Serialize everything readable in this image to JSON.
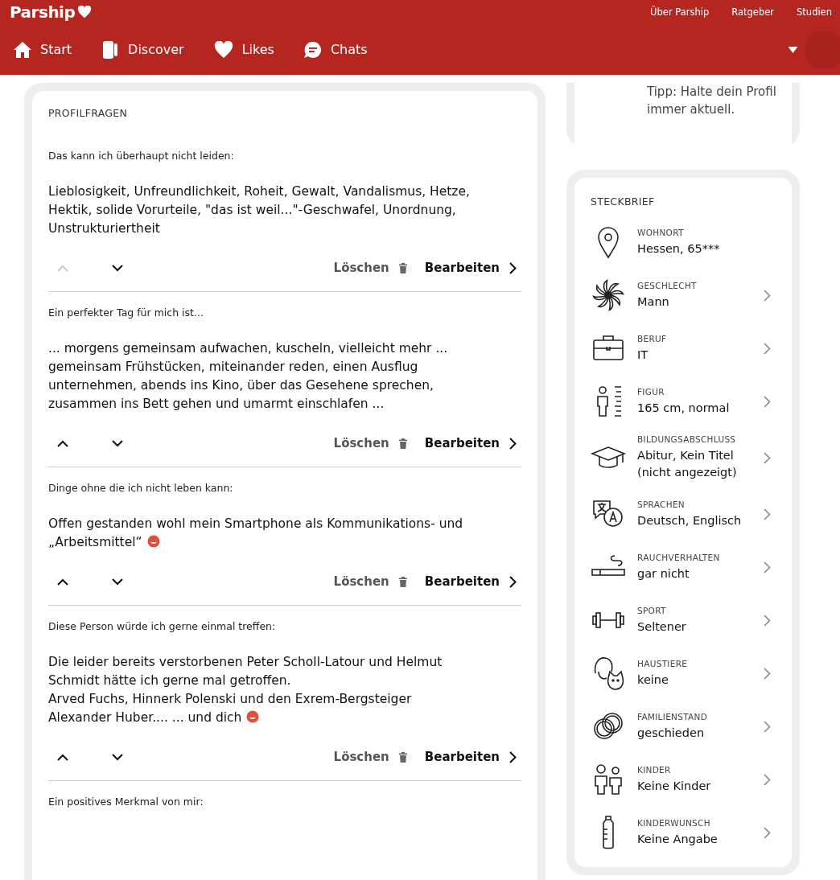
{
  "header": {
    "logo": "Parship",
    "links": [
      "Über Parship",
      "Ratgeber",
      "Studien"
    ],
    "nav": [
      {
        "label": "Start",
        "kind": "home"
      },
      {
        "label": "Discover",
        "kind": "discover"
      },
      {
        "label": "Likes",
        "kind": "heart"
      },
      {
        "label": "Chats",
        "kind": "chat"
      }
    ]
  },
  "profile_questions": {
    "title": "PROFILFRAGEN",
    "items": [
      {
        "question": "Das kann ich überhaupt nicht leiden:",
        "answer": "Lieblosigkeit, Unfreundlichkeit, Roheit, Gewalt, Vandalismus, Hetze, Hektik, solide Vorurteile, \"das ist weil...\"-Geschwafel, Unordnung, Unstrukturiertheit",
        "emoji": false,
        "up_disabled": true,
        "delete": "Löschen",
        "edit": "Bearbeiten"
      },
      {
        "question": "Ein perfekter Tag für mich ist...",
        "answer": "... morgens gemeinsam aufwachen, kuscheln, vielleicht mehr ... gemeinsam Frühstücken, miteinander reden, einen Ausflug unternehmen, abends ins Kino, über das Gesehene sprechen, zusammen ins Bett gehen und umarmt einschlafen ...",
        "emoji": false,
        "up_disabled": false,
        "delete": "Löschen",
        "edit": "Bearbeiten"
      },
      {
        "question": "Dinge ohne die ich nicht leben kann:",
        "answer": "Offen gestanden wohl mein Smartphone als Kommunikations- und „Arbeitsmittel“",
        "emoji": true,
        "up_disabled": false,
        "delete": "Löschen",
        "edit": "Bearbeiten"
      },
      {
        "question": "Diese Person würde ich gerne einmal treffen:",
        "answer": "Die leider bereits verstorbenen Peter Scholl-Latour und Helmut Schmidt hätte ich gerne mal getroffen.\nArved Fuchs, Hinnerk Polenski und den Exrem-Bergsteiger Alexander Huber.... ... und dich",
        "emoji": true,
        "up_disabled": false,
        "delete": "Löschen",
        "edit": "Bearbeiten"
      },
      {
        "question": "Ein positives Merkmal von mir:"
      }
    ]
  },
  "tip": "Tipp: Halte dein Profil immer aktuell.",
  "steckbrief": {
    "title": "STECKBRIEF",
    "items": [
      {
        "kind": "pin",
        "label": "WOHNORT",
        "value": "Hessen, 65***",
        "editable": false
      },
      {
        "kind": "gender",
        "label": "GESCHLECHT",
        "value": "Mann",
        "editable": true
      },
      {
        "kind": "briefcase",
        "label": "BERUF",
        "value": "IT",
        "editable": true
      },
      {
        "kind": "figure",
        "label": "FIGUR",
        "value": "165 cm, normal",
        "editable": true
      },
      {
        "kind": "cap",
        "label": "BILDUNGSABSCHLUSS",
        "value": "Abitur, Kein Titel (nicht angezeigt)",
        "editable": true
      },
      {
        "kind": "language",
        "label": "SPRACHEN",
        "value": "Deutsch, Englisch",
        "editable": true
      },
      {
        "kind": "cigarette",
        "label": "RAUCHVERHALTEN",
        "value": "gar nicht",
        "editable": true
      },
      {
        "kind": "dumbbell",
        "label": "SPORT",
        "value": "Seltener",
        "editable": true
      },
      {
        "kind": "pets",
        "label": "HAUSTIERE",
        "value": "keine",
        "editable": true
      },
      {
        "kind": "rings",
        "label": "FAMILIENSTAND",
        "value": "geschieden",
        "editable": true
      },
      {
        "kind": "children",
        "label": "KINDER",
        "value": "Keine Kinder",
        "editable": true
      },
      {
        "kind": "bottle",
        "label": "KINDERWUNSCH",
        "value": "Keine Angabe",
        "editable": true
      }
    ]
  }
}
